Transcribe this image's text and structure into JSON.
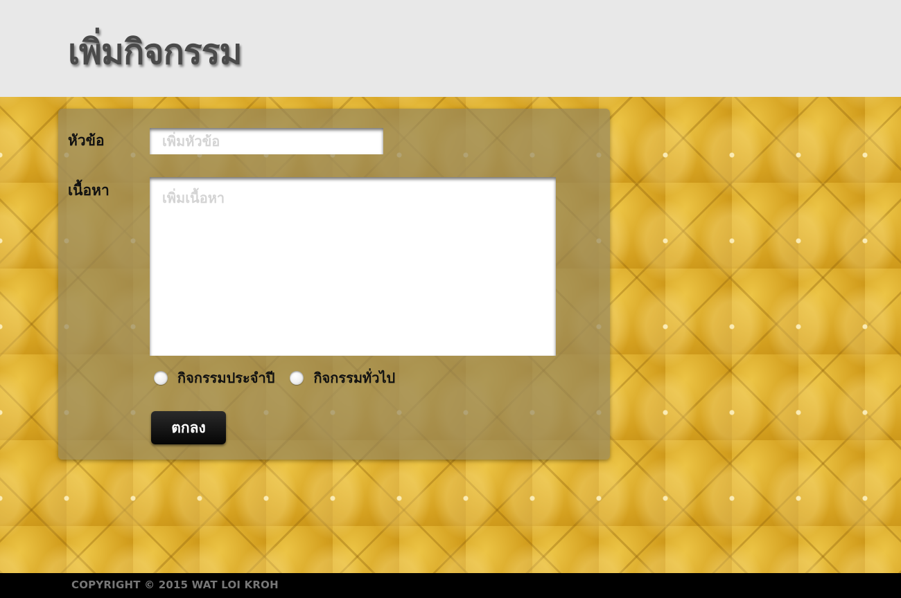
{
  "header": {
    "title": "เพิ่มกิจกรรม"
  },
  "form": {
    "title_label": "หัวข้อ",
    "title_placeholder": "เพิ่มหัวข้อ",
    "title_value": "",
    "content_label": "เนื้อหา",
    "content_placeholder": "เพิ่มเนื้อหา",
    "content_value": "",
    "radio_options": [
      {
        "label": "กิจกรรมประจำปี",
        "selected": false
      },
      {
        "label": "กิจกรรมทั่วไป",
        "selected": false
      }
    ],
    "submit_label": "ตกลง"
  },
  "footer": {
    "copyright": "COPYRIGHT © 2015 WAT LOI KROH"
  },
  "colors": {
    "header_bg": "#e8e8e8",
    "panel_bg": "rgba(150,135,90,0.72)",
    "background_gold": "#d6a424",
    "button_bg": "#050505",
    "footer_bg": "#000000"
  }
}
